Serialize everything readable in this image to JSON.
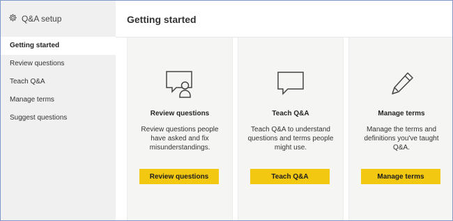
{
  "sidebar": {
    "title": "Q&A setup",
    "items": [
      {
        "label": "Getting started"
      },
      {
        "label": "Review questions"
      },
      {
        "label": "Teach Q&A"
      },
      {
        "label": "Manage terms"
      },
      {
        "label": "Suggest questions"
      }
    ]
  },
  "main": {
    "title": "Getting started",
    "cards": [
      {
        "icon": "speech-bubble-person-icon",
        "title": "Review questions",
        "description": "Review questions people have asked and fix misunderstandings.",
        "button_label": "Review questions"
      },
      {
        "icon": "speech-bubble-icon",
        "title": "Teach Q&A",
        "description": "Teach Q&A to understand questions and terms people might use.",
        "button_label": "Teach Q&A"
      },
      {
        "icon": "pencil-icon",
        "title": "Manage terms",
        "description": "Manage the terms and definitions you've taught Q&A.",
        "button_label": "Manage terms"
      }
    ]
  },
  "colors": {
    "accent": "#f2c811",
    "sidebar_bg": "#f0f0f0",
    "card_bg": "#f5f5f4",
    "frame_border": "#7f96c7"
  }
}
